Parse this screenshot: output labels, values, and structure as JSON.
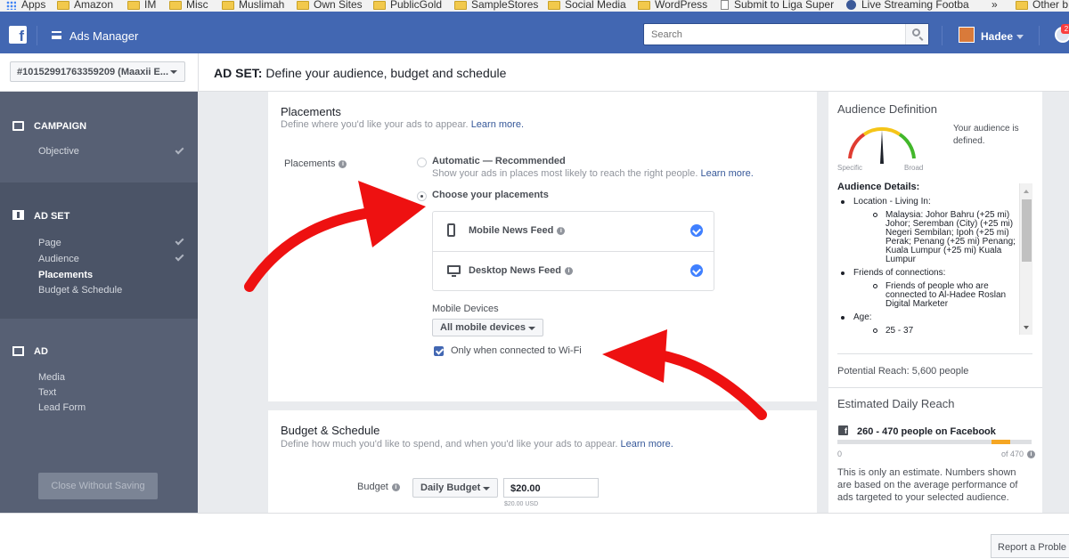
{
  "bookmarks": [
    {
      "label": "Apps",
      "icon": "apps-grid-icon"
    },
    {
      "label": "Amazon",
      "icon": "folder-icon"
    },
    {
      "label": "IM",
      "icon": "folder-icon"
    },
    {
      "label": "Misc",
      "icon": "folder-icon"
    },
    {
      "label": "Muslimah",
      "icon": "folder-icon"
    },
    {
      "label": "Own Sites",
      "icon": "folder-icon"
    },
    {
      "label": "PublicGold",
      "icon": "folder-icon"
    },
    {
      "label": "SampleStores",
      "icon": "folder-icon"
    },
    {
      "label": "Social Media",
      "icon": "folder-icon"
    },
    {
      "label": "WordPress",
      "icon": "folder-icon"
    },
    {
      "label": "Submit to Liga Super",
      "icon": "page-icon"
    },
    {
      "label": "Live Streaming Footba",
      "icon": "soccer-icon"
    },
    {
      "label": "»",
      "icon": ""
    },
    {
      "label": "Other b",
      "icon": "folder-icon"
    }
  ],
  "topnav": {
    "app_title": "Ads Manager",
    "search_placeholder": "Search",
    "username": "Hadee",
    "notification_count": "2",
    "brand_color": "#4267b2"
  },
  "header": {
    "account_select": "#10152991763359209 (Maaxii E...",
    "heading_prefix": "AD SET:",
    "heading_text": "Define your audience, budget and schedule"
  },
  "sidebar": {
    "campaign": {
      "label": "CAMPAIGN",
      "items": [
        {
          "label": "Objective",
          "done": true
        }
      ]
    },
    "adset": {
      "label": "AD SET",
      "items": [
        {
          "label": "Page",
          "done": true
        },
        {
          "label": "Audience",
          "done": true
        },
        {
          "label": "Placements",
          "done": false
        },
        {
          "label": "Budget & Schedule",
          "done": false
        }
      ]
    },
    "ad": {
      "label": "AD",
      "items": [
        {
          "label": "Media"
        },
        {
          "label": "Text"
        },
        {
          "label": "Lead Form"
        }
      ]
    },
    "close_button": "Close Without Saving"
  },
  "placements": {
    "title": "Placements",
    "subtitle": "Define where you'd like your ads to appear.",
    "learn_more": "Learn more.",
    "field_label": "Placements",
    "automatic_label": "Automatic — Recommended",
    "automatic_desc": "Show your ads in places most likely to reach the right people.",
    "automatic_learn_more": "Learn more.",
    "choose_label": "Choose your placements",
    "options": [
      {
        "label": "Mobile News Feed",
        "checked": true
      },
      {
        "label": "Desktop News Feed",
        "checked": true
      }
    ],
    "mobile_devices_label": "Mobile Devices",
    "mobile_devices_value": "All mobile devices",
    "wifi_label": "Only when connected to Wi-Fi"
  },
  "budget": {
    "title": "Budget & Schedule",
    "subtitle": "Define how much you'd like to spend, and when you'd like your ads to appear.",
    "learn_more": "Learn more.",
    "field_label": "Budget",
    "budget_type": "Daily Budget",
    "amount": "$20.00",
    "amount_note": "$20.00 USD"
  },
  "audience_definition": {
    "title": "Audience Definition",
    "status": "Your audience is defined.",
    "specific_label": "Specific",
    "broad_label": "Broad",
    "details_heading": "Audience Details:",
    "location_heading": "Location - Living In:",
    "location_value": "Malaysia: Johor Bahru (+25 mi) Johor; Seremban (City) (+25 mi) Negeri Sembilan; Ipoh (+25 mi) Perak; Penang (+25 mi) Penang; Kuala Lumpur (+25 mi) Kuala Lumpur",
    "friends_heading": "Friends of connections:",
    "friends_value": "Friends of people who are connected to Al-Hadee Roslan Digital Marketer",
    "age_heading": "Age:",
    "age_value": "25 - 37",
    "potential_reach": "Potential Reach: 5,600 people"
  },
  "estimated_reach": {
    "title": "Estimated Daily Reach",
    "range_text": "260 - 470 people on Facebook",
    "range_low": 260,
    "range_high": 470,
    "axis_min": "0",
    "axis_max": "of 470",
    "note": "This is only an estimate. Numbers shown are based on the average performance of ads targeted to your selected audience.",
    "accent_color": "#f5a623"
  },
  "footer": {
    "report_button": "Report a Proble"
  }
}
